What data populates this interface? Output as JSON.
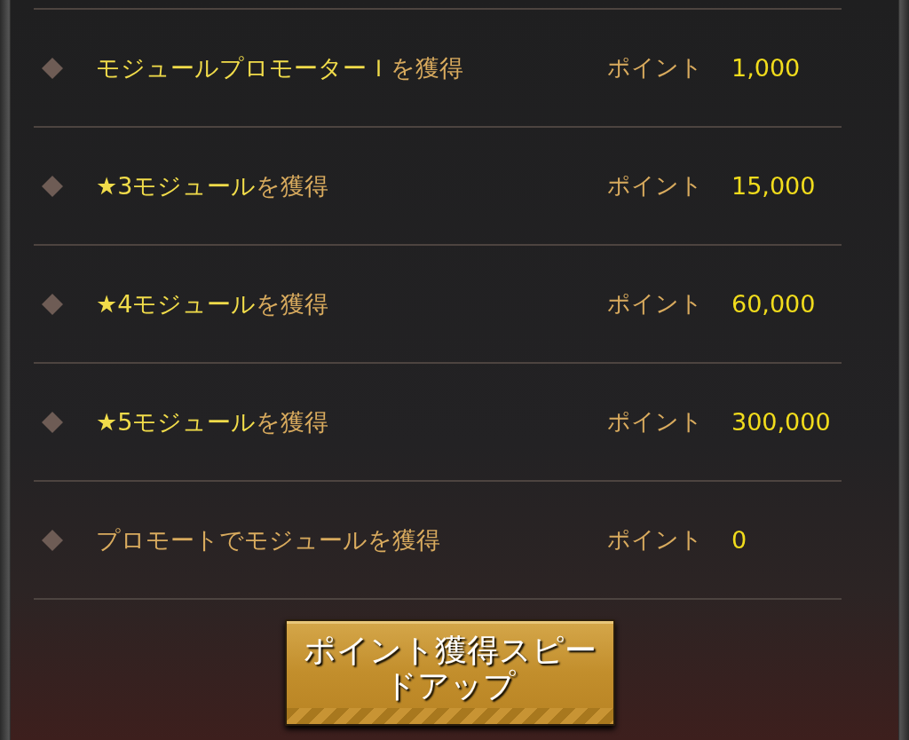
{
  "rows": [
    {
      "label": [
        {
          "text": "モジュールプロモーターＩ",
          "highlight": true
        },
        {
          "text": "を獲得",
          "highlight": false
        }
      ],
      "points_label": "ポイント",
      "points": "1,000"
    },
    {
      "label": [
        {
          "text": "★3モジュール",
          "highlight": true
        },
        {
          "text": "を獲得",
          "highlight": false
        }
      ],
      "points_label": "ポイント",
      "points": "15,000"
    },
    {
      "label": [
        {
          "text": "★4モジュール",
          "highlight": true
        },
        {
          "text": "を獲得",
          "highlight": false
        }
      ],
      "points_label": "ポイント",
      "points": "60,000"
    },
    {
      "label": [
        {
          "text": "★5モジュール",
          "highlight": true
        },
        {
          "text": "を獲得",
          "highlight": false
        }
      ],
      "points_label": "ポイント",
      "points": "300,000"
    },
    {
      "label": [
        {
          "text": "プロモートでモジュールを獲得",
          "highlight": false
        }
      ],
      "points_label": "ポイント",
      "points": "0"
    }
  ],
  "button": "ポイント獲得スピードアップ"
}
